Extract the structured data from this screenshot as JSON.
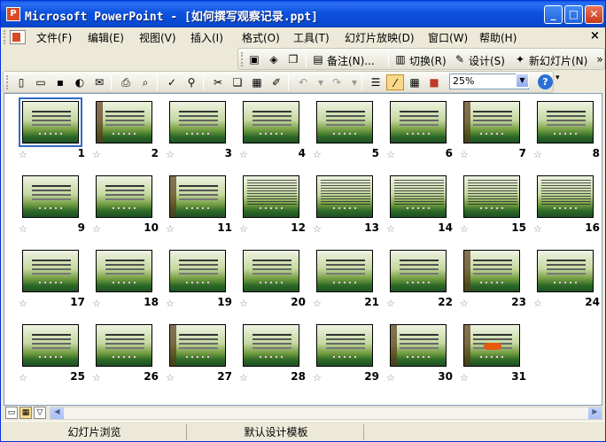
{
  "window": {
    "app_icon_letter": "P",
    "title": "Microsoft PowerPoint - [如何撰写观察记录.ppt]",
    "btn_min": "_",
    "btn_max": "□",
    "btn_close": "✕"
  },
  "menu": [
    "文件(F)",
    "编辑(E)",
    "视图(V)",
    "插入(I)",
    "格式(O)",
    "工具(T)",
    "幻灯片放映(D)",
    "窗口(W)",
    "帮助(H)"
  ],
  "menu_close": "×",
  "toolbar1": {
    "notes": "备注(N)...",
    "transition": "切换(R)",
    "design": "设计(S)",
    "new_slide": "新幻灯片(N)"
  },
  "toolbar2": {
    "zoom": "25%",
    "help": "?"
  },
  "slides": [
    {
      "n": "1",
      "style": "title"
    },
    {
      "n": "2",
      "style": "tree"
    },
    {
      "n": "3",
      "style": "text"
    },
    {
      "n": "4",
      "style": "text"
    },
    {
      "n": "5",
      "style": "text"
    },
    {
      "n": "6",
      "style": "text"
    },
    {
      "n": "7",
      "style": "tree"
    },
    {
      "n": "8",
      "style": "text"
    },
    {
      "n": "9",
      "style": "text"
    },
    {
      "n": "10",
      "style": "text"
    },
    {
      "n": "11",
      "style": "tree"
    },
    {
      "n": "12",
      "style": "dense"
    },
    {
      "n": "13",
      "style": "dense"
    },
    {
      "n": "14",
      "style": "dense"
    },
    {
      "n": "15",
      "style": "dense"
    },
    {
      "n": "16",
      "style": "dense"
    },
    {
      "n": "17",
      "style": "text"
    },
    {
      "n": "18",
      "style": "text"
    },
    {
      "n": "19",
      "style": "text"
    },
    {
      "n": "20",
      "style": "text"
    },
    {
      "n": "21",
      "style": "text"
    },
    {
      "n": "22",
      "style": "text"
    },
    {
      "n": "23",
      "style": "tree"
    },
    {
      "n": "24",
      "style": "text"
    },
    {
      "n": "25",
      "style": "text"
    },
    {
      "n": "26",
      "style": "text"
    },
    {
      "n": "27",
      "style": "tree"
    },
    {
      "n": "28",
      "style": "text"
    },
    {
      "n": "29",
      "style": "text"
    },
    {
      "n": "30",
      "style": "tree"
    },
    {
      "n": "31",
      "style": "fire"
    }
  ],
  "star_glyph": "☆",
  "status": {
    "view": "幻灯片浏览",
    "template": "默认设计模板"
  }
}
